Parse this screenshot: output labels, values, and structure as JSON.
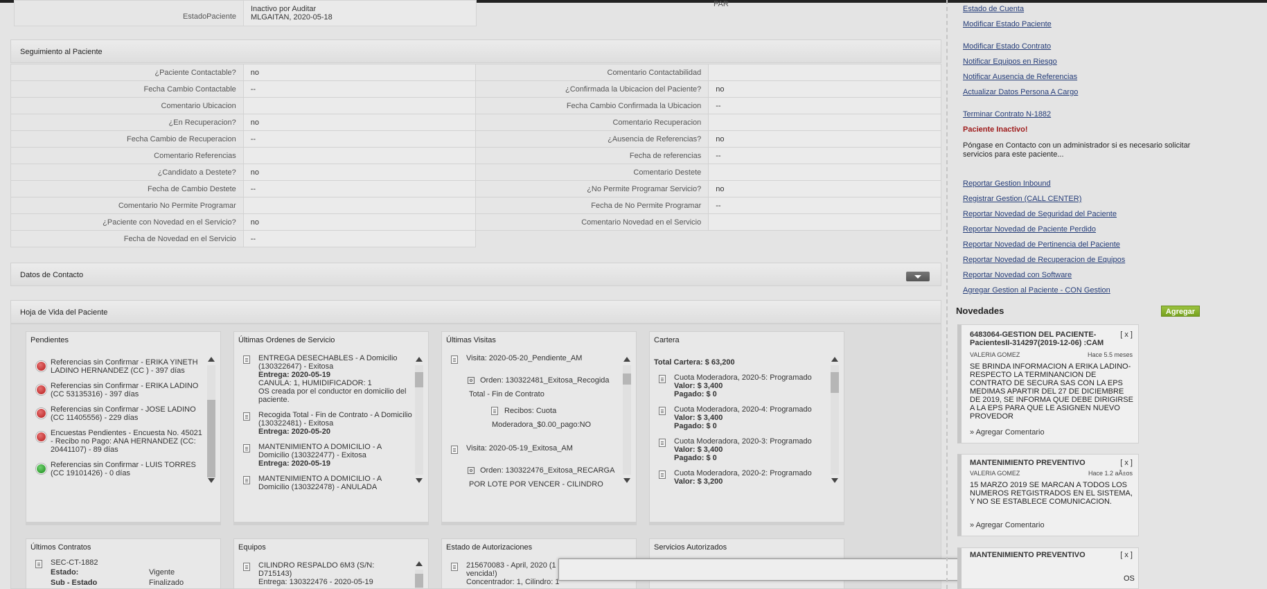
{
  "status": {
    "estado_label": "EstadoPaciente",
    "estado_value": "Inactivo por Auditar",
    "estado_sub": "MLGAITAN, 2020-05-18",
    "par": "PAR"
  },
  "seguimiento": {
    "title": "Seguimiento al Paciente",
    "rows": [
      {
        "l1": "¿Paciente Contactable?",
        "v1": "no",
        "l2": "Comentario Contactabilidad",
        "v2": ""
      },
      {
        "l1": "Fecha Cambio Contactable",
        "v1": "--",
        "l2": "¿Confirmada la Ubicacion del Paciente?",
        "v2": "no"
      },
      {
        "l1": "Comentario Ubicacion",
        "v1": "",
        "l2": "Fecha Cambio Confirmada la Ubicacion",
        "v2": "--"
      },
      {
        "l1": "¿En Recuperacion?",
        "v1": "no",
        "l2": "Comentario Recuperacion",
        "v2": ""
      },
      {
        "l1": "Fecha Cambio de Recuperacion",
        "v1": "--",
        "l2": "¿Ausencia de Referencias?",
        "v2": "no"
      },
      {
        "l1": "Comentario Referencias",
        "v1": "",
        "l2": "Fecha de referencias",
        "v2": "--"
      },
      {
        "l1": "¿Candidato a Destete?",
        "v1": "no",
        "l2": "Comentario Destete",
        "v2": ""
      },
      {
        "l1": "Fecha de Cambio Destete",
        "v1": "--",
        "l2": "¿No Permite Programar Servicio?",
        "v2": "no"
      },
      {
        "l1": "Comentario No Permite Programar",
        "v1": "",
        "l2": "Fecha de No Permite Programar",
        "v2": "--"
      },
      {
        "l1": "¿Paciente con Novedad en el Servicio?",
        "v1": "no",
        "l2": "Comentario Novedad en el Servicio",
        "v2": ""
      },
      {
        "l1": "Fecha de Novedad en el Servicio",
        "v1": "--",
        "l2": null,
        "v2": null
      }
    ]
  },
  "datos_contacto": {
    "title": "Datos de Contacto"
  },
  "hoja": {
    "title": "Hoja de Vida del Paciente"
  },
  "pendientes": {
    "title": "Pendientes",
    "items": [
      {
        "status": "red",
        "text": "Referencias sin Confirmar - ERIKA YINETH LADINO HERNANDEZ (CC ) - 397 días"
      },
      {
        "status": "red",
        "text": "Referencias sin Confirmar - ERIKA LADINO (CC 53135316) - 397 días"
      },
      {
        "status": "red",
        "text": "Referencias sin Confirmar - JOSE LADINO (CC 11405556) - 229 días"
      },
      {
        "status": "red",
        "text": "Encuestas Pendientes - Encuesta No. 45021 - Recibo no Pago: ANA HERNANDEZ (CC: 20441107) - 89 días"
      },
      {
        "status": "green",
        "text": "Referencias sin Confirmar - LUIS TORRES (CC 19101426) - 0 días"
      }
    ]
  },
  "ordenes": {
    "title": "Últimas Ordenes de Servicio",
    "items": [
      {
        "text": "ENTREGA DESECHABLES - A Domicilio (130322647) - Exitosa",
        "bold": "Entrega: 2020-05-19",
        "extra": "CANULA: 1, HUMIDIFICADOR: 1",
        "extra2": "OS creada por el conductor en domicilio del paciente."
      },
      {
        "text": "Recogida Total - Fin de Contrato - A Domicilio (130322481) - Exitosa",
        "bold": "Entrega: 2020-05-20",
        "extra": "",
        "extra2": ""
      },
      {
        "text": "MANTENIMIENTO A DOMICILIO - A Domicilio (130322477) - Exitosa",
        "bold": "Entrega: 2020-05-19",
        "extra": "",
        "extra2": ""
      },
      {
        "text": "MANTENIMIENTO A DOMICILIO - A Domicilio (130322478) - ANULADA",
        "bold": "",
        "extra": "",
        "extra2": ""
      }
    ]
  },
  "visitas": {
    "title": "Últimas Visitas",
    "v1": "Visita: 2020-05-20_Pendiente_AM",
    "o1": "Orden: 130322481_Exitosa_Recogida",
    "o1b": "Total - Fin de Contrato",
    "r1": "Recibos: Cuota",
    "r1b": "Moderadora_$0.00_pago:NO",
    "v2": "Visita: 2020-05-19_Exitosa_AM",
    "o2": "Orden: 130322476_Exitosa_RECARGA",
    "o2b": "POR LOTE POR VENCER - CILINDRO"
  },
  "cartera": {
    "title": "Cartera",
    "total": "Total Cartera: $ 63,200",
    "items": [
      {
        "text": "Cuota Moderadora, 2020-5: Programado",
        "valor": "Valor: $ 3,400",
        "pagado": "Pagado: $ 0"
      },
      {
        "text": "Cuota Moderadora, 2020-4: Programado",
        "valor": "Valor: $ 3,400",
        "pagado": "Pagado: $ 0"
      },
      {
        "text": "Cuota Moderadora, 2020-3: Programado",
        "valor": "Valor: $ 3,400",
        "pagado": "Pagado: $ 0"
      },
      {
        "text": "Cuota Moderadora, 2020-2: Programado",
        "valor": "Valor: $ 3,200",
        "pagado": ""
      }
    ]
  },
  "contratos": {
    "title": "Últimos Contratos",
    "code": "SEC-CT-1882",
    "estado_l": "Estado:",
    "estado_v": "Vigente",
    "sub_l": "Sub - Estado",
    "sub_v": "Finalizado"
  },
  "equipos": {
    "title": "Equipos",
    "text": "CILINDRO RESPALDO 6M3 (S/N: D715143)",
    "entrega": "Entrega: 130322476 - 2020-05-19"
  },
  "autorizaciones": {
    "title": "Estado de Autorizaciones",
    "text": "215670083 - April, 2020 (1",
    "text2": "vencida!)",
    "text3": "Concentrador: 1, Cilindro: 1"
  },
  "servicios": {
    "title": "Servicios Autorizados"
  },
  "sidebar": {
    "links_top": [
      "Estado de Cuenta",
      "Modificar Estado Paciente"
    ],
    "links_mid": [
      "Modificar Estado Contrato",
      "Notificar Equipos en Riesgo",
      "Notificar Ausencia de Referencias",
      "Actualizar Datos Persona A Cargo"
    ],
    "terminar": "Terminar Contrato N-1882",
    "inactive": "Paciente Inactivo!",
    "note": "Póngase en Contacto con un administrador si es necesario solicitar servicios para este paciente...",
    "links_bottom": [
      "Reportar Gestion Inbound",
      "Registrar Gestion (CALL CENTER)",
      "Reportar Novedad de Seguridad del Paciente",
      "Reportar Novedad de Paciente Perdido",
      "Reportar Novedad de Pertinencia del Paciente",
      "Reportar Novedad de Recuperacion de Equipos",
      "Reportar Novedad con Software",
      "Agregar Gestion al Paciente - CON Gestion"
    ],
    "novedades": "Novedades",
    "agregar": "Agregar"
  },
  "novedades": [
    {
      "title": "6483064-GESTION DEL PACIENTE-PacientesII-314297(2019-12-06) :CAM",
      "user": "VALERIA GOMEZ",
      "time": "Hace 5.5 meses",
      "body": "SE BRINDA INFORMACION A ERIKA LADINO- RESPECTO LA TERMINANCION DE CONTRATO DE SECURA SAS CON LA EPS MEDIMAS APARTIR DEL 27 DE DICIEMBRE DE 2019, SE INFORMA QUE DEBE DIRIGIRSE A LA EPS PARA QUE LE ASIGNEN NUEVO PROVEDOR",
      "comment": "» Agregar Comentario",
      "x": "[ x ]"
    },
    {
      "title": "MANTENIMIENTO PREVENTIVO",
      "user": "VALERIA GOMEZ",
      "time": "Hace 1.2 aÃ±os",
      "body": "15 MARZO 2019 SE MARCAN A TODOS LOS NUMEROS RETGISTRADOS EN EL SISTEMA, Y NO SE ESTABLECE COMUNICACION.",
      "comment": "» Agregar Comentario",
      "x": "[ x ]"
    },
    {
      "title": "MANTENIMIENTO PREVENTIVO",
      "user": "",
      "time": "",
      "body": "OS",
      "comment": "",
      "x": "[ x ]"
    }
  ],
  "modal": {
    "close": "✖"
  }
}
